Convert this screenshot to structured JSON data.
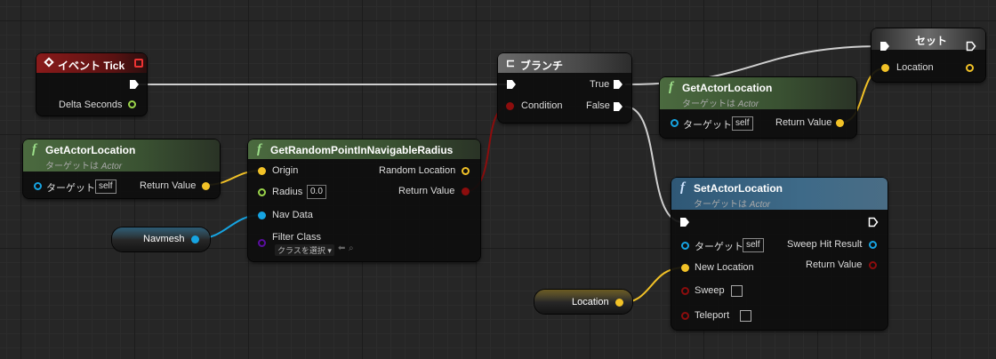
{
  "colors": {
    "exec": "#ffffff",
    "vector": "#f2c227",
    "float": "#9ad44a",
    "bool": "#8c0d0d",
    "object": "#16a4e2",
    "class": "#5a0ea0",
    "event_header": "#8a1a1a",
    "func_header": "#4b6a3f",
    "branch_header": "#5b5b5b",
    "set_header": "#5b5b5b",
    "setactor_header": "#2f5876"
  },
  "event_tick": {
    "icon": "event-diamond-icon",
    "title": "イベント Tick",
    "pin_delta": "Delta Seconds"
  },
  "get_actor_location_1": {
    "title": "GetActorLocation",
    "subtitle_prefix": "ターゲットは",
    "subtitle_class": "Actor",
    "pin_target": "ターゲット",
    "self_label": "self",
    "pin_return": "Return Value"
  },
  "get_random_point": {
    "title": "GetRandomPointInNavigableRadius",
    "pin_origin": "Origin",
    "pin_radius": "Radius",
    "radius_value": "0.0",
    "pin_nav_data": "Nav Data",
    "pin_filter_class": "Filter Class",
    "filter_dropdown": "クラスを選択",
    "pin_random_location": "Random Location",
    "pin_return": "Return Value"
  },
  "navmesh_var": {
    "label": "Navmesh"
  },
  "branch": {
    "title": "ブランチ",
    "pin_condition": "Condition",
    "pin_true": "True",
    "pin_false": "False"
  },
  "get_actor_location_2": {
    "title": "GetActorLocation",
    "subtitle_prefix": "ターゲットは",
    "subtitle_class": "Actor",
    "pin_target": "ターゲット",
    "self_label": "self",
    "pin_return": "Return Value"
  },
  "set_node": {
    "title": "セット",
    "pin_location": "Location"
  },
  "set_actor_location": {
    "title": "SetActorLocation",
    "subtitle_prefix": "ターゲットは",
    "subtitle_class": "Actor",
    "pin_target": "ターゲット",
    "self_label": "self",
    "pin_new_location": "New Location",
    "pin_sweep": "Sweep",
    "pin_teleport": "Teleport",
    "pin_sweep_hit": "Sweep Hit Result",
    "pin_return": "Return Value"
  },
  "location_var": {
    "label": "Location"
  }
}
